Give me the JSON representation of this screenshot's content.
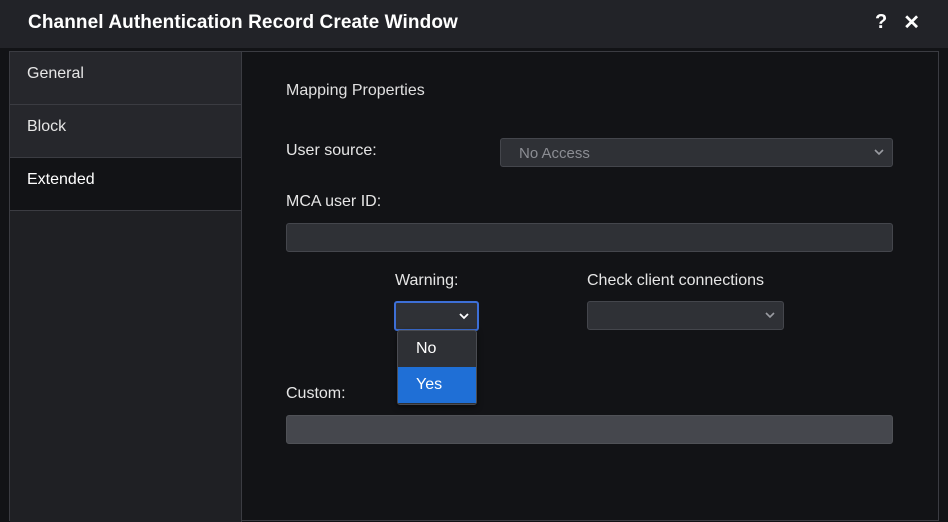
{
  "window": {
    "title": "Channel Authentication Record Create Window",
    "help_label": "?",
    "close_label": "✕"
  },
  "sidebar": {
    "tabs": [
      {
        "label": "General"
      },
      {
        "label": "Block"
      },
      {
        "label": "Extended"
      }
    ],
    "active_tab": "Extended"
  },
  "main": {
    "section_title": "Mapping Properties",
    "user_source": {
      "label": "User source:",
      "value": "No Access"
    },
    "mca_user_id": {
      "label": "MCA user ID:",
      "value": ""
    },
    "warning": {
      "label": "Warning:",
      "value": "",
      "options": [
        "No",
        "Yes"
      ],
      "highlighted": "Yes"
    },
    "check_client_connections": {
      "label": "Check client connections",
      "value": ""
    },
    "custom": {
      "label": "Custom:",
      "value": ""
    }
  },
  "colors": {
    "accent": "#1f6fd6",
    "focus_border": "#3d6fd6",
    "background": "#121316",
    "titlebar": "#222328"
  }
}
